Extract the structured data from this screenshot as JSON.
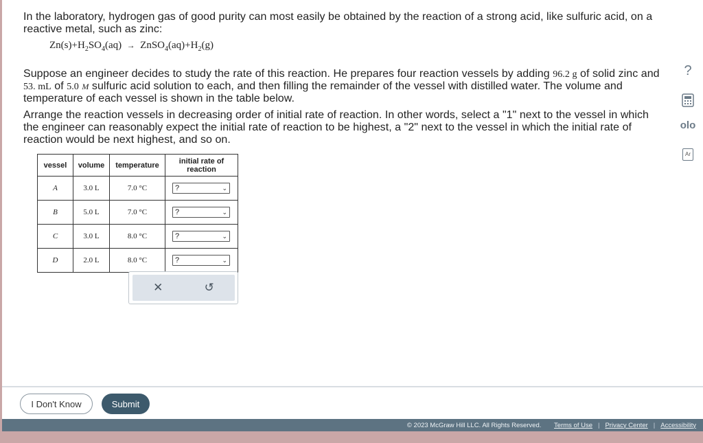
{
  "question": {
    "intro": "In the laboratory, hydrogen gas of good purity can most easily be obtained by the reaction of a strong acid, like sulfuric acid, on a reactive metal, such as zinc:",
    "equation": {
      "reactant1": "Zn(s)",
      "plus1": "+",
      "reactant2_pre": "H",
      "reactant2_sub1": "2",
      "reactant2_mid": "SO",
      "reactant2_sub2": "4",
      "reactant2_post": "(aq)",
      "arrow": "→",
      "product1_pre": "ZnSO",
      "product1_sub": "4",
      "product1_post": "(aq)",
      "plus2": "+",
      "product2_pre": "H",
      "product2_sub": "2",
      "product2_post": "(g)"
    },
    "setup_a": "Suppose an engineer decides to study the rate of this reaction. He prepares four reaction vessels by adding",
    "zinc_mass": "96.2 g",
    "setup_b": "of solid zinc and",
    "acid_volume": "53. mL",
    "setup_c": "of",
    "acid_conc": "5.0",
    "acid_unit": "M",
    "setup_d": "sulfuric acid solution to each, and then filling the remainder of the vessel with distilled water. The volume and temperature of each vessel is shown in the table below.",
    "instructions": "Arrange the reaction vessels in decreasing order of initial rate of reaction. In other words, select a \"1\" next to the vessel in which the engineer can reasonably expect the initial rate of reaction to be highest, a \"2\" next to the vessel in which the initial rate of reaction would be next highest, and so on."
  },
  "table": {
    "headers": [
      "vessel",
      "volume",
      "temperature",
      "initial rate of reaction"
    ],
    "rows": [
      {
        "vessel": "A",
        "volume": "3.0 L",
        "temperature": "7.0 °C",
        "rank": "?"
      },
      {
        "vessel": "B",
        "volume": "5.0 L",
        "temperature": "7.0 °C",
        "rank": "?"
      },
      {
        "vessel": "C",
        "volume": "3.0 L",
        "temperature": "8.0 °C",
        "rank": "?"
      },
      {
        "vessel": "D",
        "volume": "2.0 L",
        "temperature": "8.0 °C",
        "rank": "?"
      }
    ]
  },
  "actions": {
    "clear": "✕",
    "undo": "↺"
  },
  "side_tools": {
    "help": "?",
    "graph": "olo",
    "periodic": "Ar"
  },
  "buttons": {
    "dont_know": "I Don't Know",
    "submit": "Submit"
  },
  "footer": {
    "copyright": "© 2023 McGraw Hill LLC. All Rights Reserved.",
    "terms": "Terms of Use",
    "privacy": "Privacy Center",
    "accessibility": "Accessibility"
  }
}
